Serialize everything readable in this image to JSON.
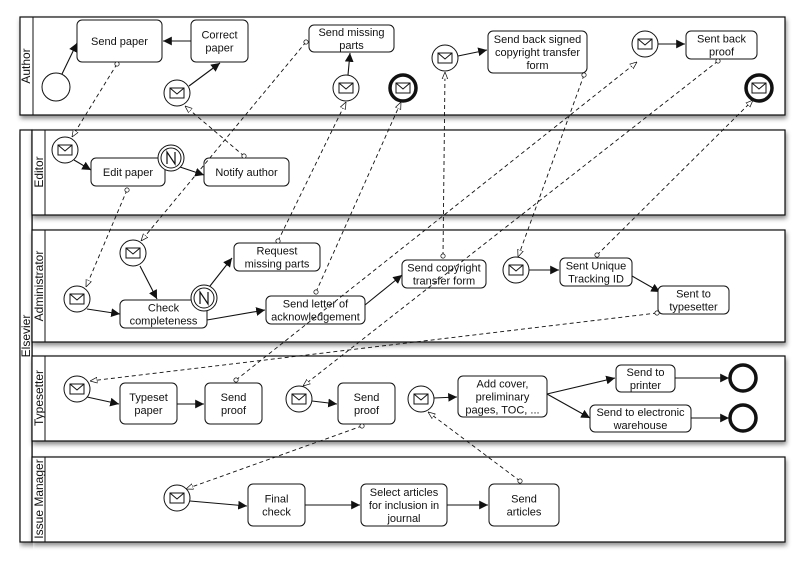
{
  "pools": {
    "author": "Author",
    "elsevier": "Elsevier"
  },
  "lanes": {
    "editor": "Editor",
    "administrator": "Administrator",
    "typesetter": "Typesetter",
    "issue_manager": "Issue Manager"
  },
  "tasks": {
    "send_paper": [
      "Send paper"
    ],
    "correct_paper": [
      "Correct",
      "paper"
    ],
    "send_missing_parts": [
      "Send missing",
      "parts"
    ],
    "send_back_signed_form": [
      "Send back signed",
      "copyright transfer",
      "form"
    ],
    "sent_back_proof": [
      "Sent back",
      "proof"
    ],
    "edit_paper": [
      "Edit paper"
    ],
    "notify_author": [
      "Notify author"
    ],
    "check_completeness": [
      "Check",
      "completeness"
    ],
    "request_missing_parts": [
      "Request",
      "missing parts"
    ],
    "send_letter_ack": [
      "Send letter of",
      "acknowledgement"
    ],
    "send_copyright_form": [
      "Send copyright",
      "transfer form"
    ],
    "sent_tracking_id": [
      "Sent Unique",
      "Tracking ID"
    ],
    "sent_to_typesetter": [
      "Sent to",
      "typesetter"
    ],
    "typeset_paper": [
      "Typeset",
      "paper"
    ],
    "send_proof_1": [
      "Send",
      "proof"
    ],
    "send_proof_2": [
      "Send",
      "proof"
    ],
    "add_cover": [
      "Add cover,",
      "preliminary",
      "pages, TOC, ..."
    ],
    "send_to_printer": [
      "Send to",
      "printer"
    ],
    "send_to_warehouse": [
      "Send to electronic",
      "warehouse"
    ],
    "final_check": [
      "Final",
      "check"
    ],
    "select_articles": [
      "Select articles",
      "for inclusion in",
      "journal"
    ],
    "send_articles": [
      "Send",
      "articles"
    ]
  },
  "icons": {
    "message_event": "envelope-icon",
    "intermediate_event": "N-link-icon",
    "start_event": "circle",
    "end_event": "thick-circle"
  }
}
